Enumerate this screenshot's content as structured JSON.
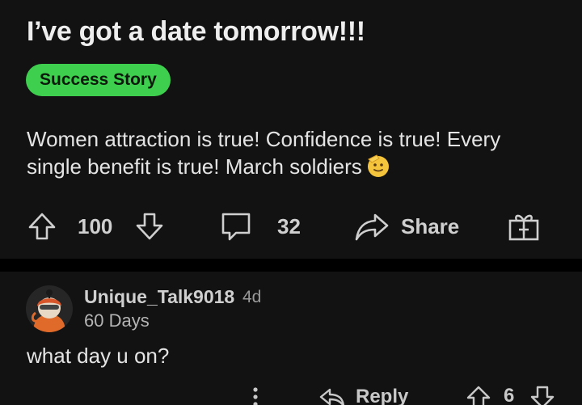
{
  "post": {
    "title": "I’ve got a date tomorrow!!!",
    "flair": "Success Story",
    "flair_color": "#3ecf4f",
    "body": "Women attraction is true! Confidence is true! Every single benefit is true! March soldiers",
    "body_emoji": "saluting-face-emoji",
    "actions": {
      "upvote_icon": "arrow-up-icon",
      "votes": "100",
      "downvote_icon": "arrow-down-icon",
      "comment_icon": "comment-icon",
      "comments": "32",
      "share_icon": "share-arrow-icon",
      "share_label": "Share",
      "award_icon": "gift-award-icon"
    }
  },
  "comment": {
    "avatar": "user-avatar",
    "username": "Unique_Talk9018",
    "age": "4d",
    "user_flair": "60 Days",
    "text": "what day u on?",
    "actions": {
      "more_icon": "more-vertical-icon",
      "reply_icon": "reply-icon",
      "reply_label": "Reply",
      "upvote_icon": "arrow-up-icon",
      "votes": "6",
      "downvote_icon": "arrow-down-icon"
    }
  }
}
